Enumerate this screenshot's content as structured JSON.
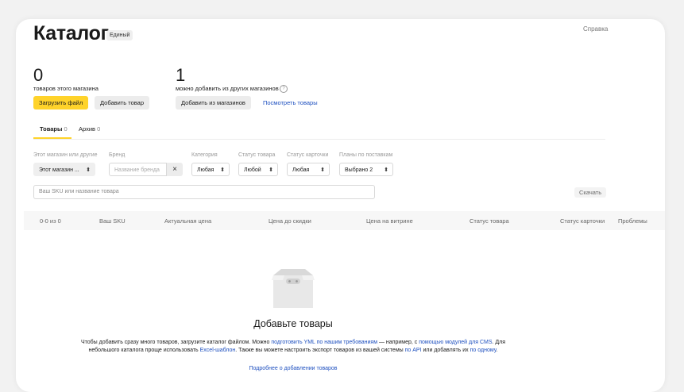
{
  "header": {
    "title": "Каталог",
    "badge": "Единый",
    "help": "Справка"
  },
  "stats": {
    "own": {
      "count": "0",
      "caption": "товаров этого магазина",
      "upload_btn": "Загрузить файл",
      "add_btn": "Добавить товар"
    },
    "other": {
      "count": "1",
      "caption": "можно добавить из других магазинов",
      "info": "?",
      "add_btn": "Добавить из магазинов",
      "view_link": "Посмотреть товары"
    }
  },
  "tabs": [
    {
      "label": "Товары",
      "count": "0"
    },
    {
      "label": "Архив",
      "count": "0"
    }
  ],
  "filters": {
    "shop": {
      "label": "Этот магазин или другие",
      "value": "Этот магазин ..."
    },
    "brand": {
      "label": "Бренд",
      "placeholder": "Название бренда",
      "clear": "×"
    },
    "category": {
      "label": "Категория",
      "value": "Любая"
    },
    "status": {
      "label": "Статус товара",
      "value": "Любой"
    },
    "card_status": {
      "label": "Статус карточки",
      "value": "Любая"
    },
    "plans": {
      "label": "Планы по поставкам",
      "value": "Выбрано 2"
    },
    "arrow": "⬍"
  },
  "search": {
    "placeholder": "Ваш SKU или название товара",
    "download": "Скачать"
  },
  "table": {
    "counter": "0-0 из 0",
    "headers": [
      "Ваш SKU",
      "Актуальная цена",
      "Цена до скидки",
      "Цена на витрине",
      "Статус товара",
      "Статус карточки",
      "Проблемы"
    ]
  },
  "empty": {
    "title": "Добавьте товары",
    "line1_a": "Чтобы добавить сразу много товаров, загрузите каталог файлом. Можно ",
    "line1_link1": "подготовить YML по нашим требованиям",
    "line1_b": " — например, с ",
    "line1_link2": "помощью модулей для CMS",
    "line1_c": ". Для",
    "line2_a": "небольшого каталога проще использовать ",
    "line2_link1": "Excel-шаблон",
    "line2_b": ". Также вы можете настроить экспорт товаров из вашей системы ",
    "line2_link2": "по API",
    "line2_c": " или добавлять их ",
    "line2_link3": "по одному",
    "line2_d": ".",
    "more_link": "Подробнее о добавлении товаров"
  },
  "colors": {
    "accent": "#ffd32a",
    "link": "#1d4fbf"
  }
}
